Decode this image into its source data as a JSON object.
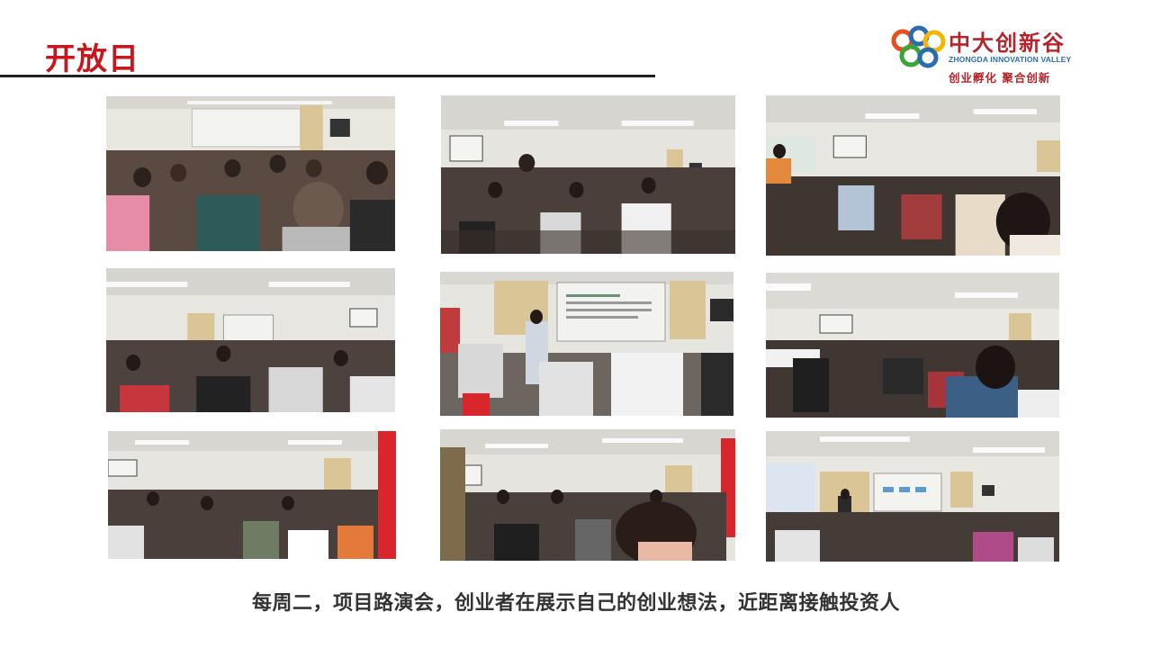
{
  "slide": {
    "title": "开放日",
    "caption": "每周二，项目路演会，创业者在展示自己的创业想法，近距离接触投资人"
  },
  "logo": {
    "name_cn": "中大创新谷",
    "name_en": "ZHONGDA INNOVATION VALLEY",
    "slogan": "创业孵化 聚合创新",
    "colors": [
      "#e94e1b",
      "#2b6cb0",
      "#3aa538",
      "#f2b705",
      "#b5242a"
    ]
  },
  "photos": [
    {
      "caption": "",
      "screen_text": ""
    },
    {
      "caption": "",
      "screen_text": ""
    },
    {
      "caption": "",
      "screen_text": ""
    },
    {
      "caption": "",
      "screen_text": ""
    },
    {
      "caption": "",
      "screen_text": ""
    },
    {
      "caption": "",
      "screen_text": ""
    },
    {
      "caption": "",
      "screen_text": ""
    },
    {
      "caption": "",
      "screen_text": ""
    },
    {
      "caption": "",
      "screen_text": ""
    }
  ],
  "colors": {
    "title": "#c8161d",
    "rule": "#222222",
    "caption": "#333333"
  }
}
